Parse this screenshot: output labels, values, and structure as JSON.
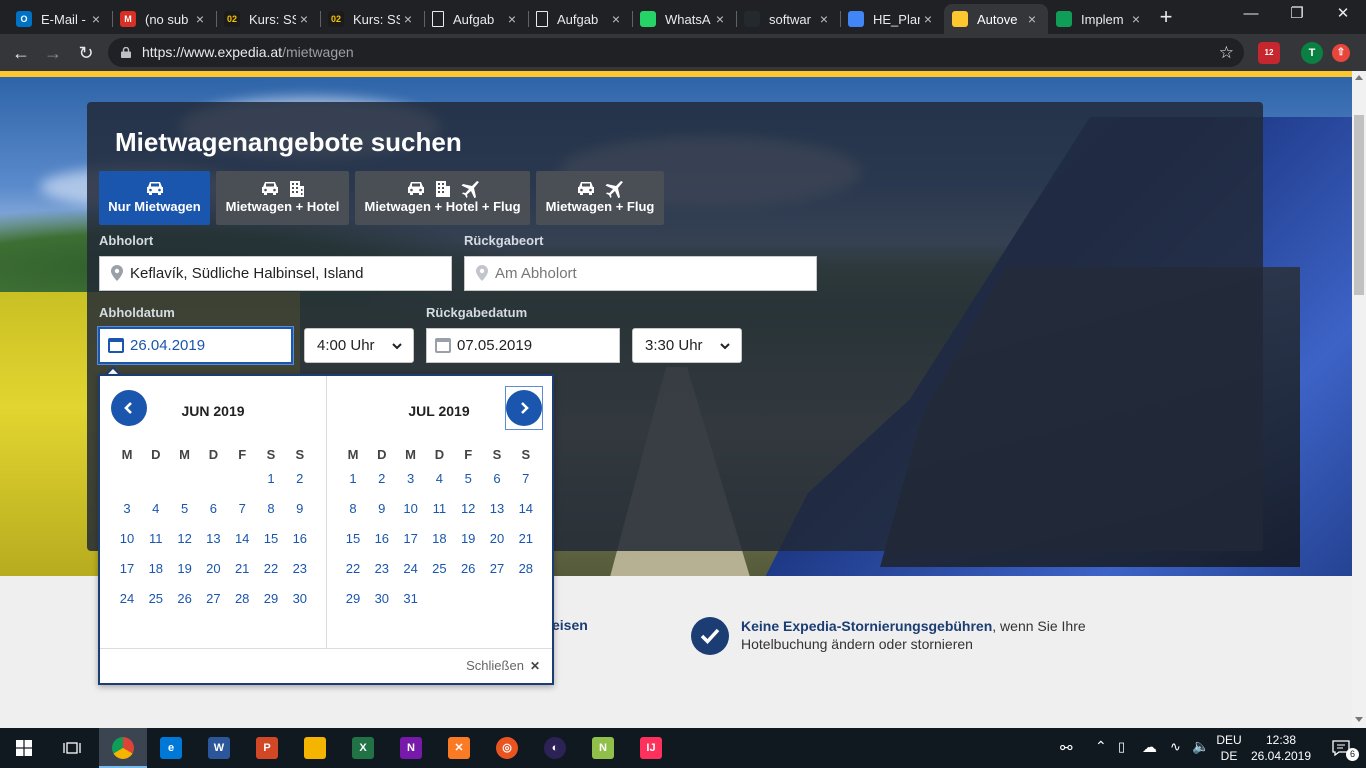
{
  "browser": {
    "tabs": [
      {
        "label": "E-Mail -",
        "icon": "outlook-icon",
        "color": "#0072c6"
      },
      {
        "label": "(no sub",
        "icon": "gmail-icon",
        "color": "#d93025"
      },
      {
        "label": "Kurs: SS",
        "icon": "moodle-icon",
        "color": "#1b1b1b"
      },
      {
        "label": "Kurs: SS",
        "icon": "moodle-icon",
        "color": "#1b1b1b"
      },
      {
        "label": "Aufgab",
        "icon": "document-icon",
        "color": "#ffffff"
      },
      {
        "label": "Aufgab",
        "icon": "document-icon",
        "color": "#ffffff"
      },
      {
        "label": "WhatsA",
        "icon": "whatsapp-icon",
        "color": "#25d366"
      },
      {
        "label": "softwar",
        "icon": "github-icon",
        "color": "#24292e"
      },
      {
        "label": "HE_Plar",
        "icon": "google-docs-icon",
        "color": "#4285f4"
      },
      {
        "label": "Autove",
        "icon": "expedia-icon",
        "color": "#fdc82f"
      },
      {
        "label": "Implem",
        "icon": "infinity-icon",
        "color": "#0f9d58"
      }
    ],
    "url_host": "https://www.expedia.at",
    "url_path": "/mietwagen",
    "extension_badge": "12"
  },
  "search": {
    "title": "Mietwagenangebote suchen",
    "tabs": [
      {
        "label": "Nur Mietwagen",
        "icons": [
          "car-icon"
        ]
      },
      {
        "label": "Mietwagen + Hotel",
        "icons": [
          "car-icon",
          "hotel-icon"
        ]
      },
      {
        "label": "Mietwagen + Hotel + Flug",
        "icons": [
          "car-icon",
          "hotel-icon",
          "plane-icon"
        ]
      },
      {
        "label": "Mietwagen + Flug",
        "icons": [
          "car-icon",
          "plane-icon"
        ]
      }
    ],
    "pickup_label": "Abholort",
    "pickup_value": "Keflavík, Südliche Halbinsel, Island",
    "dropoff_label": "Rückgabeort",
    "dropoff_placeholder": "Am Abholort",
    "pickup_date_label": "Abholdatum",
    "pickup_date": "26.04.2019",
    "pickup_time": "4:00 Uhr",
    "return_date_label": "Rückgabedatum",
    "return_date": "07.05.2019",
    "return_time": "3:30 Uhr"
  },
  "calendar": {
    "weekdays": [
      "M",
      "D",
      "M",
      "D",
      "F",
      "S",
      "S"
    ],
    "months": [
      {
        "title": "JUN 2019",
        "first_weekday": 5,
        "days": 30
      },
      {
        "title": "JUL 2019",
        "first_weekday": 0,
        "days": 31
      }
    ],
    "close_label": "Schließen",
    "close_symbol": "✕"
  },
  "benefits": {
    "partial_text": "eisen",
    "bold": "Keine Expedia-Stornierungsgebühren",
    "text": ", wenn Sie Ihre Hotelbuchung ändern oder stornieren"
  },
  "taskbar": {
    "apps": [
      {
        "name": "chrome",
        "active": true
      },
      {
        "name": "edge"
      },
      {
        "name": "word"
      },
      {
        "name": "powerpoint"
      },
      {
        "name": "file-explorer"
      },
      {
        "name": "excel"
      },
      {
        "name": "onenote"
      },
      {
        "name": "xampp"
      },
      {
        "name": "ubuntu"
      },
      {
        "name": "eclipse"
      },
      {
        "name": "notepad-plus"
      },
      {
        "name": "intellij"
      }
    ],
    "lang_top": "DEU",
    "lang_bottom": "DE",
    "time": "12:38",
    "date": "26.04.2019",
    "notification_count": "6"
  }
}
